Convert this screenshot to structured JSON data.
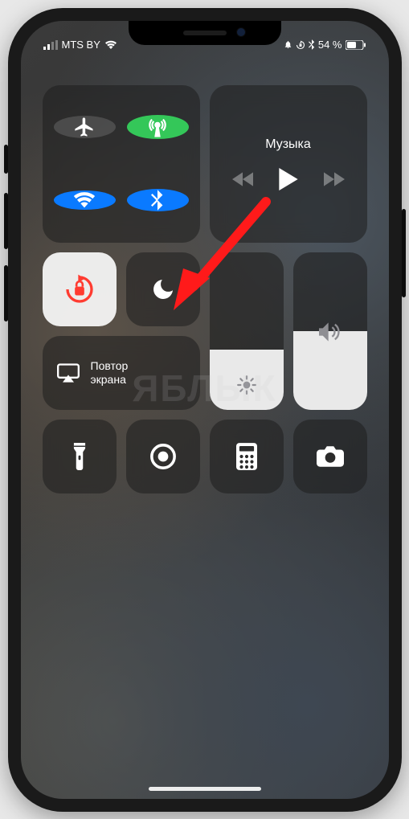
{
  "status": {
    "carrier": "MTS BY",
    "battery_pct": "54 %"
  },
  "media": {
    "title": "Музыка"
  },
  "mirror": {
    "label": "Повтор\nэкрана"
  },
  "watermark": "ЯБЛЫК",
  "sliders": {
    "brightness_pct": 38,
    "volume_pct": 50
  },
  "toggles": {
    "airplane": false,
    "cellular": true,
    "wifi": true,
    "bluetooth": true,
    "orientation_lock": true,
    "dnd": false
  }
}
